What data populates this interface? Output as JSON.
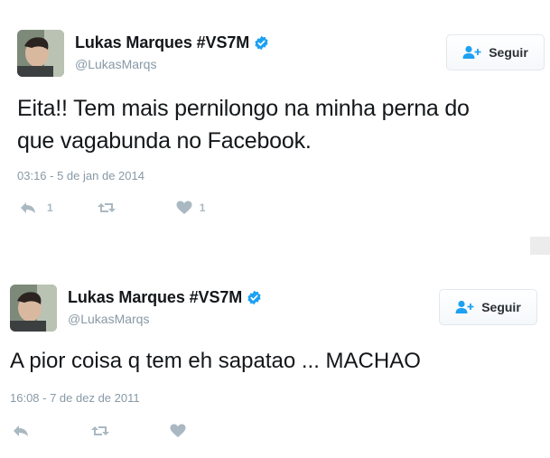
{
  "tweets": [
    {
      "name": "Lukas Marques #VS7M",
      "handle": "@LukasMarqs",
      "follow_label": "Seguir",
      "text_lines": [
        "Eita!! Tem mais pernilongo na minha perna do",
        "que vagabunda no Facebook."
      ],
      "timestamp": "03:16 - 5 de jan de 2014",
      "replies": "1",
      "retweets": "",
      "likes": "1"
    },
    {
      "name": "Lukas Marques #VS7M",
      "handle": "@LukasMarqs",
      "follow_label": "Seguir",
      "text_lines": [
        "A pior coisa q tem eh sapatao ... MACHAO"
      ],
      "timestamp": "16:08 - 7 de dez de 2011",
      "replies": "",
      "retweets": "",
      "likes": ""
    }
  ],
  "icons": {
    "verified": "verified-badge-icon",
    "follow": "add-user-icon",
    "reply": "reply-icon",
    "retweet": "retweet-icon",
    "like": "heart-icon"
  },
  "colors": {
    "verified": "#1da1f2",
    "follow_icon": "#1da1f2",
    "muted": "#8899a6",
    "action": "#aab8c2"
  }
}
